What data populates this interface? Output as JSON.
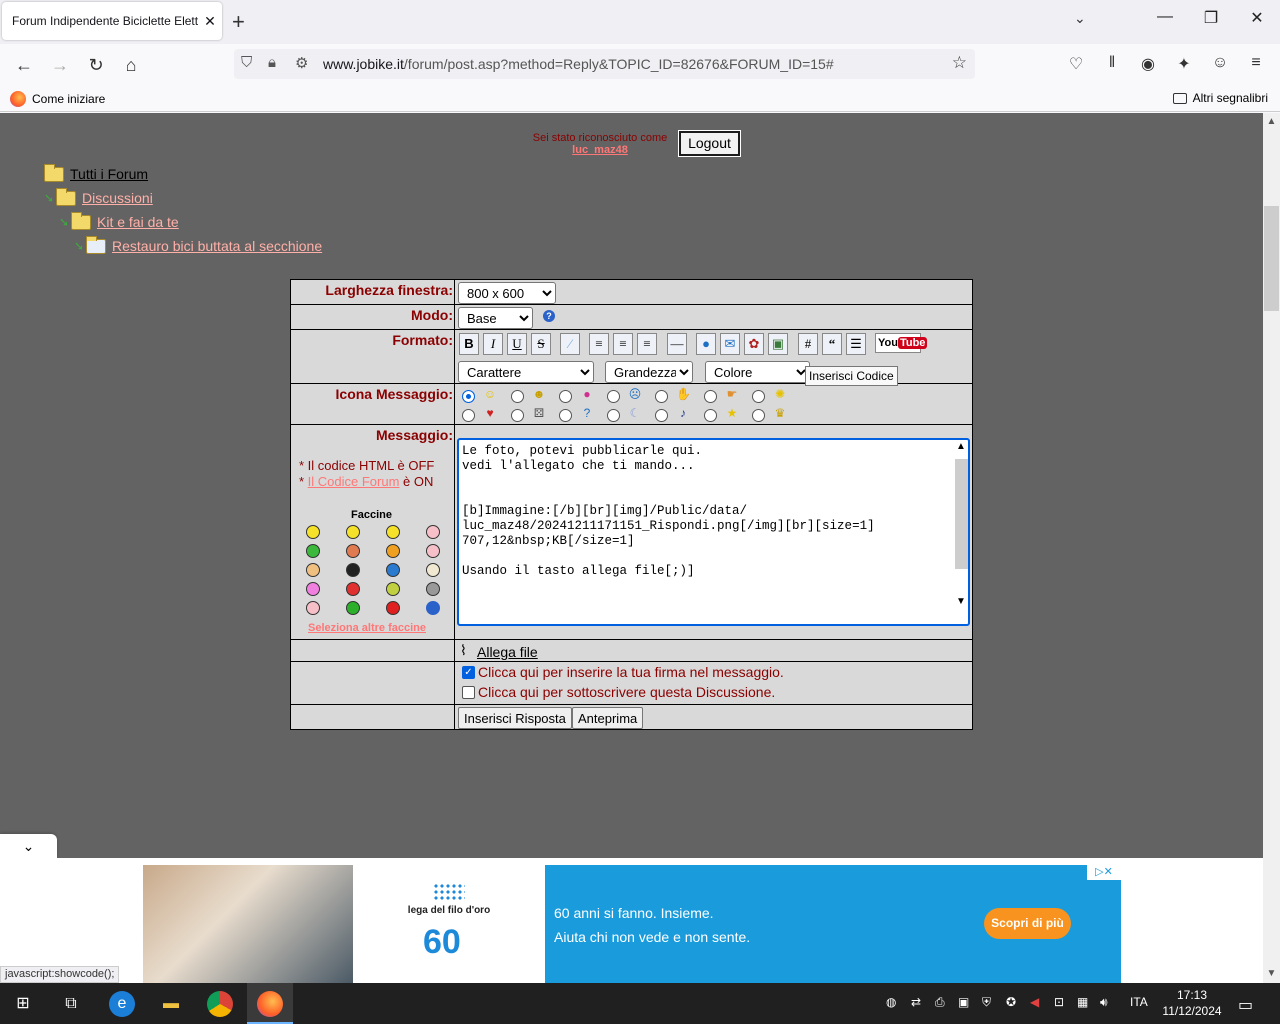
{
  "browser": {
    "tab_title": "Forum Indipendente Biciclette Elett",
    "tab_close": "✕",
    "new_tab": "+",
    "url_domain": "www.jobike.it",
    "url_path": "/forum/post.asp?method=Reply&TOPIC_ID=82676&FORUM_ID=15#",
    "bookmark_left": "Come iniziare",
    "bookmark_right": "Altri segnalibri",
    "status_text": "javascript:showcode();"
  },
  "login": {
    "text": "Sei stato riconosciuto come",
    "user": "luc_maz48",
    "logout_label": "Logout"
  },
  "breadcrumb": [
    {
      "label": "Tutti i Forum"
    },
    {
      "label": "Discussioni"
    },
    {
      "label": "Kit e fai da te"
    },
    {
      "label": "Restauro bici buttata al secchione"
    }
  ],
  "form": {
    "width_label": "Larghezza finestra:",
    "width_value": "800 x 600",
    "mode_label": "Modo:",
    "mode_value": "Base",
    "format_label": "Formato:",
    "font_select": "Carattere",
    "size_select": "Grandezza",
    "color_select": "Colore",
    "youtube_label": "You",
    "youtube_label2": "Tube",
    "icon_label": "Icona Messaggio:",
    "message_label": "Messaggio:",
    "html_note_prefix": "* Il codice HTML è ",
    "html_note_state": "OFF",
    "forum_code_prefix": "* ",
    "forum_code_link": "Il Codice Forum",
    "forum_code_suffix": " è ON",
    "faccine_title": "Faccine",
    "altre_faccine": "Seleziona altre faccine",
    "message_text": "Le foto, potevi pubblicarle qui.\nvedi l'allegato che ti mando...\n\n\n[b]Immagine:[/b][br][img]/Public/data/\nluc_maz48/20241211171151_Rispondi.png[/img][br][size=1]\n707,12&nbsp;KB[/size=1]\n\nUsando il tasto allega file[;)]\n\n",
    "attach_label": "Allega file",
    "signature_label": "Clicca qui per inserire la tua firma nel messaggio.",
    "subscribe_label": "Clicca qui per sottoscrivere questa Discussione.",
    "submit_label": "Inserisci Risposta",
    "preview_label": "Anteprima",
    "tooltip": "Inserisci Codice"
  },
  "ad": {
    "brand": "lega del filo d'oro",
    "line1": "60 anni si fanno. Insieme.",
    "line2": "Aiuta chi non vede e non sente.",
    "cta": "Scopri di più",
    "sixty": "60"
  },
  "taskbar": {
    "lang": "ITA",
    "time": "17:13",
    "date": "11/12/2024"
  },
  "colors": {
    "page_bg": "#636363",
    "label_red": "#8b0000",
    "link_pink": "#ff7777",
    "ad_blue": "#1a9bdb",
    "ad_orange": "#f7931e"
  }
}
